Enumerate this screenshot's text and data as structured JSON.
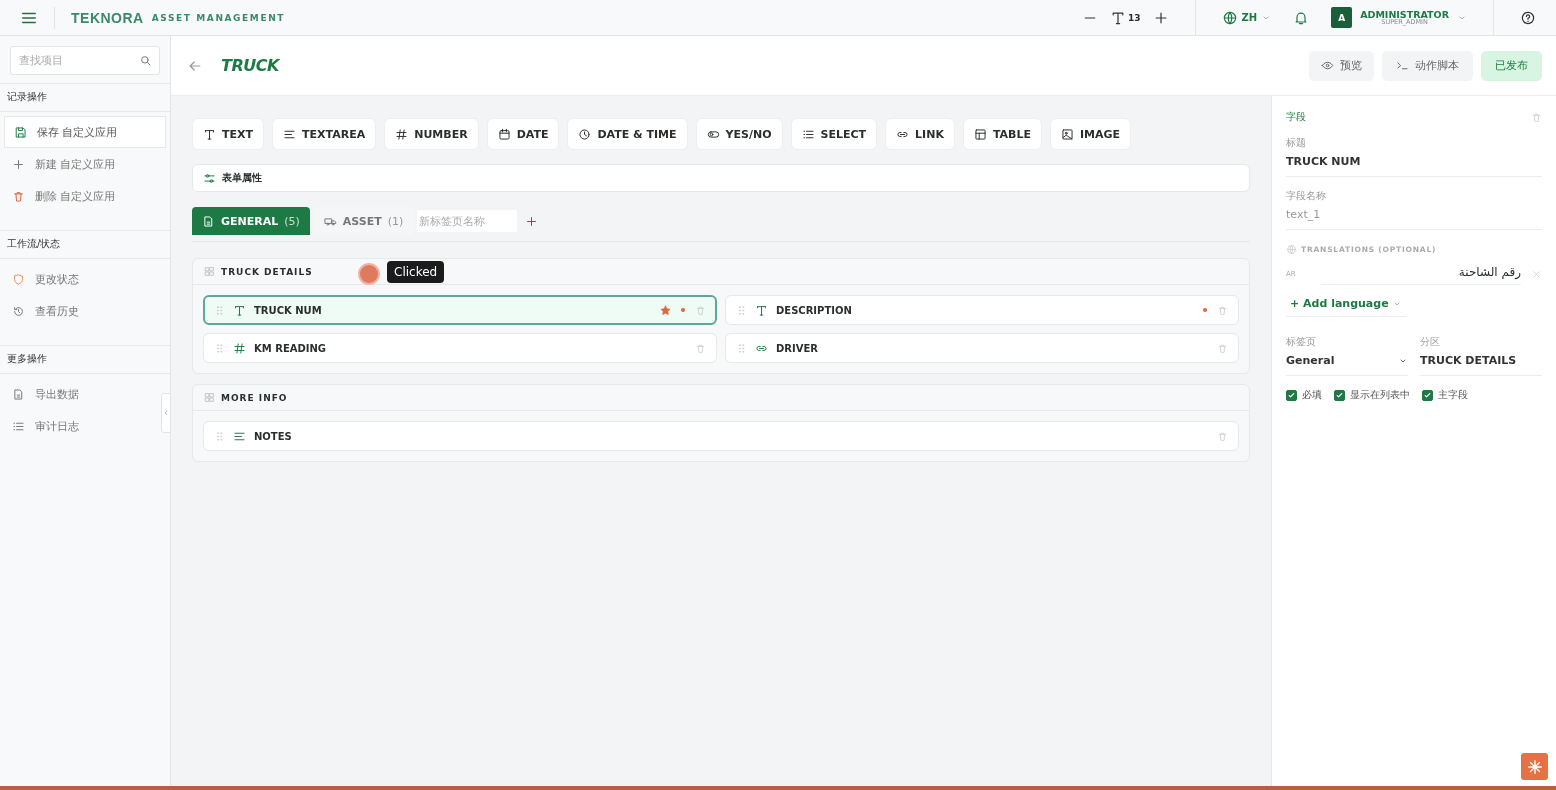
{
  "topbar": {
    "brand": "TEKNORA",
    "brand_sub": "ASSET MANAGEMENT",
    "font_size": "13",
    "language": "ZH",
    "user_initial": "A",
    "user_name": "ADMINISTRATOR",
    "user_role": "SUPER_ADMIN"
  },
  "sidebar": {
    "search": {
      "placeholder": "查找项目"
    },
    "groups": [
      {
        "title": "记录操作",
        "items": [
          {
            "label": "保存 自定义应用",
            "selected": true
          },
          {
            "label": "新建 自定义应用",
            "selected": false
          },
          {
            "label": "删除 自定义应用",
            "selected": false
          }
        ]
      },
      {
        "title": "工作流/状态",
        "items": [
          {
            "label": "更改状态",
            "selected": false
          },
          {
            "label": "查看历史",
            "selected": false
          }
        ]
      },
      {
        "title": "更多操作",
        "items": [
          {
            "label": "导出数据",
            "selected": false
          },
          {
            "label": "审计日志",
            "selected": false
          }
        ]
      }
    ]
  },
  "header": {
    "title": "TRUCK",
    "actions": [
      {
        "label": "预览",
        "kind": "preview"
      },
      {
        "label": "动作脚本",
        "kind": "script"
      },
      {
        "label": "已发布",
        "kind": "published"
      }
    ]
  },
  "palette": [
    {
      "label": "TEXT",
      "kind": "text"
    },
    {
      "label": "TEXTAREA",
      "kind": "textarea"
    },
    {
      "label": "NUMBER",
      "kind": "number"
    },
    {
      "label": "DATE",
      "kind": "date"
    },
    {
      "label": "DATE & TIME",
      "kind": "datetime"
    },
    {
      "label": "YES/NO",
      "kind": "toggle"
    },
    {
      "label": "SELECT",
      "kind": "select"
    },
    {
      "label": "LINK",
      "kind": "link"
    },
    {
      "label": "TABLE",
      "kind": "table"
    },
    {
      "label": "IMAGE",
      "kind": "image"
    }
  ],
  "form_props": "表单属性",
  "tabs": [
    {
      "label": "GENERAL",
      "count": "(5)",
      "selected": true
    },
    {
      "label": "ASSET",
      "count": "(1)",
      "selected": false
    }
  ],
  "new_tab": {
    "placeholder": "新标签页名称"
  },
  "sections": [
    {
      "title": "TRUCK DETAILS",
      "fields": [
        {
          "label": "TRUCK NUM",
          "kind": "text",
          "selected": true,
          "primary": true,
          "required": true
        },
        {
          "label": "DESCRIPTION",
          "kind": "text",
          "selected": false,
          "primary": false,
          "required": true
        },
        {
          "label": "KM READING",
          "kind": "number",
          "selected": false,
          "primary": false,
          "required": false
        },
        {
          "label": "DRIVER",
          "kind": "link",
          "selected": false,
          "primary": false,
          "required": false
        }
      ]
    },
    {
      "title": "MORE INFO",
      "fields": [
        {
          "label": "NOTES",
          "kind": "textarea",
          "selected": false,
          "primary": false,
          "required": false
        }
      ]
    }
  ],
  "tooltip": "Clicked",
  "panel": {
    "title": "字段",
    "label_caption": "标题",
    "label_value": "TRUCK NUM",
    "name_caption": "字段名称",
    "name_value": "text_1",
    "translations_title": "TRANSLATIONS (OPTIONAL)",
    "translations": [
      {
        "lang": "AR",
        "value": "رقم الشاحنة"
      }
    ],
    "add_language": "+ Add language",
    "tab_caption": "标签页",
    "tab_value": "General",
    "section_caption": "分区",
    "section_value": "TRUCK DETAILS",
    "checks": [
      {
        "label": "必填",
        "checked": true
      },
      {
        "label": "显示在列表中",
        "checked": true
      },
      {
        "label": "主字段",
        "checked": true
      }
    ]
  }
}
